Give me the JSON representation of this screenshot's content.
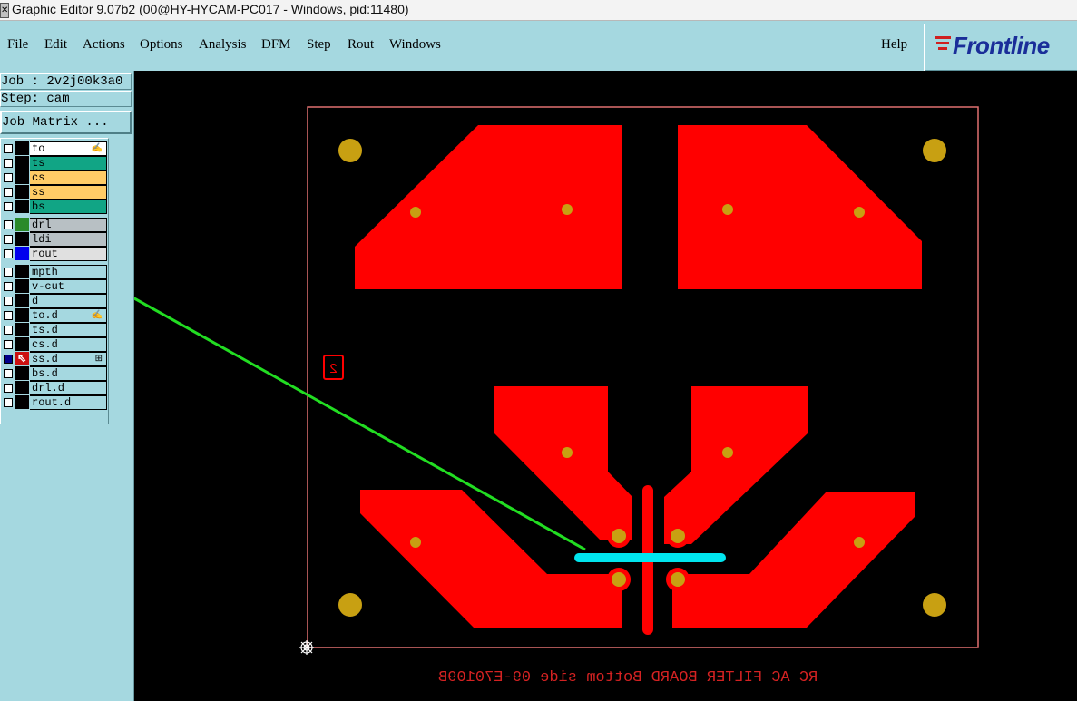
{
  "window": {
    "title": "Graphic Editor 9.07b2 (00@HY-HYCAM-PC017 - Windows, pid:11480)"
  },
  "menu": {
    "items": [
      "File",
      "Edit",
      "Actions",
      "Options",
      "Analysis",
      "DFM",
      "Step",
      "Rout",
      "Windows"
    ],
    "help": "Help"
  },
  "logo": {
    "text": "Frontline"
  },
  "info": {
    "job": "Job : 2v2j00k3a0",
    "step": "Step: cam",
    "job_matrix": "Job Matrix ..."
  },
  "layers": [
    {
      "name": "to",
      "bg": "#ffffff",
      "swatch": "#000000",
      "mark": "✍"
    },
    {
      "name": "ts",
      "bg": "#11a585",
      "swatch": "#000000"
    },
    {
      "name": "cs",
      "bg": "#ffcc66",
      "swatch": "#000000"
    },
    {
      "name": "ss",
      "bg": "#ffcc66",
      "swatch": "#000000"
    },
    {
      "name": "bs",
      "bg": "#11a585",
      "swatch": "#000000"
    },
    {
      "name": "drl",
      "bg": "#b8c0c4",
      "swatch": "#2a8a2a"
    },
    {
      "name": "ldi",
      "bg": "#b8c0c4",
      "swatch": "#000000"
    },
    {
      "name": "rout",
      "bg": "#e0e0e0",
      "swatch": "#0000ee"
    },
    {
      "name": "mpth",
      "bg": "#a5d8e0",
      "swatch": "#000000"
    },
    {
      "name": "v-cut",
      "bg": "#a5d8e0",
      "swatch": "#000000"
    },
    {
      "name": "d",
      "bg": "#a5d8e0",
      "swatch": "#000000"
    },
    {
      "name": "to.d",
      "bg": "#a5d8e0",
      "swatch": "#000000",
      "mark": "✍"
    },
    {
      "name": "ts.d",
      "bg": "#a5d8e0",
      "swatch": "#000000"
    },
    {
      "name": "cs.d",
      "bg": "#a5d8e0",
      "swatch": "#000000"
    },
    {
      "name": "ss.d",
      "bg": "#a5d8e0",
      "swatch": "#cc1111",
      "active": true,
      "mark": "⊞"
    },
    {
      "name": "bs.d",
      "bg": "#a5d8e0",
      "swatch": "#000000"
    },
    {
      "name": "drl.d",
      "bg": "#a5d8e0",
      "swatch": "#000000"
    },
    {
      "name": "rout.d",
      "bg": "#a5d8e0",
      "swatch": "#000000"
    }
  ],
  "board": {
    "marker_label": "2",
    "bottom_text": "RC AC FILTER BOARD Bottom side 09-E70109B",
    "colors": {
      "copper": "#ff0000",
      "pad": "#c8a012",
      "outline": "#e07070",
      "rout": "#00e5ee",
      "arrow": "#22dd22"
    }
  }
}
